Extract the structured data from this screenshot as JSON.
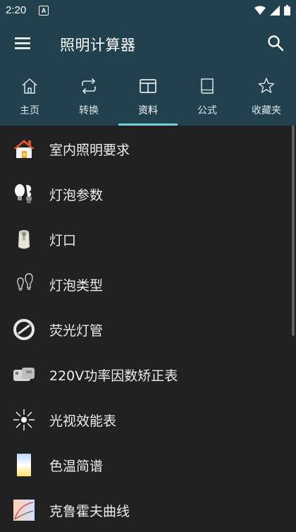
{
  "status_bar": {
    "time": "2:20",
    "notification_glyph": "A"
  },
  "app_bar": {
    "title": "照明计算器",
    "menu_icon": "hamburger-menu-icon",
    "search_icon": "search-icon"
  },
  "tabs": [
    {
      "label": "主页",
      "icon": "home-icon",
      "active": false
    },
    {
      "label": "转换",
      "icon": "repeat-icon",
      "active": false
    },
    {
      "label": "资料",
      "icon": "panel-icon",
      "active": true
    },
    {
      "label": "公式",
      "icon": "book-icon",
      "active": false
    },
    {
      "label": "收藏夹",
      "icon": "star-icon",
      "active": false
    }
  ],
  "accent_color": "#6fd3d9",
  "header_color": "#22414f",
  "items": [
    {
      "label": "室内照明要求",
      "icon": "house-icon"
    },
    {
      "label": "灯泡参数",
      "icon": "bulbs-icon"
    },
    {
      "label": "灯口",
      "icon": "lamp-socket-icon"
    },
    {
      "label": "灯泡类型",
      "icon": "bulb-outline-icon"
    },
    {
      "label": "荧光灯管",
      "icon": "fluorescent-ring-icon"
    },
    {
      "label": "220V功率因数矫正表",
      "icon": "capacitor-icon"
    },
    {
      "label": "光视效能表",
      "icon": "sunburst-icon"
    },
    {
      "label": "色温简谱",
      "icon": "color-temperature-icon"
    },
    {
      "label": "克鲁霍夫曲线",
      "icon": "curve-chart-icon"
    }
  ]
}
